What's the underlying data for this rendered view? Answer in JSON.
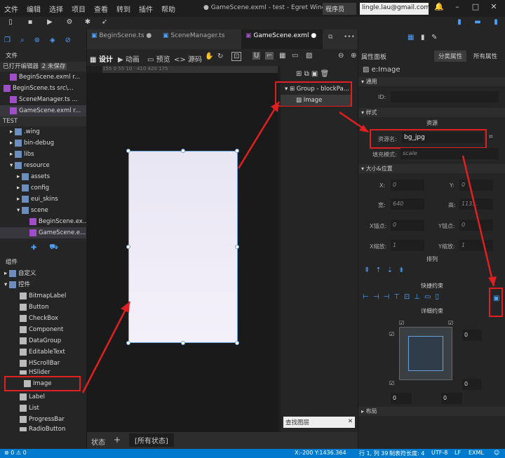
{
  "menu": [
    "文件",
    "编辑",
    "选择",
    "项目",
    "查看",
    "转到",
    "插件",
    "帮助"
  ],
  "window_title": "● GameScene.exml - test - Egret Wing",
  "role": "程序员",
  "email": "lingle.lau@gmail.com",
  "left": {
    "file_label": "文件",
    "open_editors": "已打开编辑器",
    "unsaved": "2 未保存",
    "open_files": [
      "BeginScene.exml r...",
      "BeginScene.ts src\\...",
      "SceneManager.ts ...",
      "GameScene.exml r..."
    ],
    "project": "TEST",
    "tree": [
      ".wing",
      "bin-debug",
      "libs",
      "resource",
      "assets",
      "config",
      "eui_skins",
      "scene",
      "BeginScene.ex...",
      "GameScene.e..."
    ],
    "components_label": "组件",
    "custom": "自定义",
    "controls": "控件",
    "controls_list": [
      "BitmapLabel",
      "Button",
      "CheckBox",
      "Component",
      "DataGroup",
      "EditableText",
      "HScrollBar",
      "HSlider",
      "Image",
      "Label",
      "List",
      "ProgressBar",
      "RadioButton"
    ]
  },
  "editor": {
    "tabs": [
      "BeginScene.ts",
      "SceneManager.ts",
      "GameScene.exml"
    ],
    "modes": [
      "设计",
      "动画",
      "预览",
      "源码"
    ],
    "ruler": "155  0  55  10  ·  410  420  175",
    "layers": [
      "Group - blockPa...",
      "Image"
    ],
    "search_layers": "查找图层",
    "state_label": "状态",
    "all_states": "[所有状态]"
  },
  "right": {
    "title": "属性面板",
    "tab_cat": "分类属性",
    "tab_all": "所有属性",
    "component": "e:Image",
    "sec_common": "通用",
    "id_label": "ID:",
    "sec_style": "样式",
    "sec_res": "资源",
    "source_label": "资源名:",
    "source_value": "bg_jpg",
    "fill_label": "填充模式:",
    "fill_value": "scale",
    "sec_size": "大小&位置",
    "x_label": "X:",
    "x": "0",
    "y_label": "Y:",
    "y": "0",
    "w_label": "宽:",
    "w": "640",
    "h_label": "高:",
    "h": "113...",
    "ax_label": "X锚点:",
    "ax": "0",
    "ay_label": "Y锚点:",
    "ay": "0",
    "sx_label": "X缩放:",
    "sx": "1",
    "sy_label": "Y缩放:",
    "sy": "1",
    "sec_arrange": "排列",
    "sec_quick": "快捷约束",
    "sec_detail": "详细约束",
    "c_top": "0",
    "c_bottom": "0",
    "c_left": "0",
    "c_right": "0",
    "sec_layout": "布局"
  },
  "status": {
    "errors": "0",
    "warnings": "0",
    "coords": "X:-200 Y:1436.364",
    "pos": "行 1, 列 39",
    "tab": "制表符长度: 4",
    "enc": "UTF-8",
    "eol": "LF",
    "lang": "EXML"
  }
}
